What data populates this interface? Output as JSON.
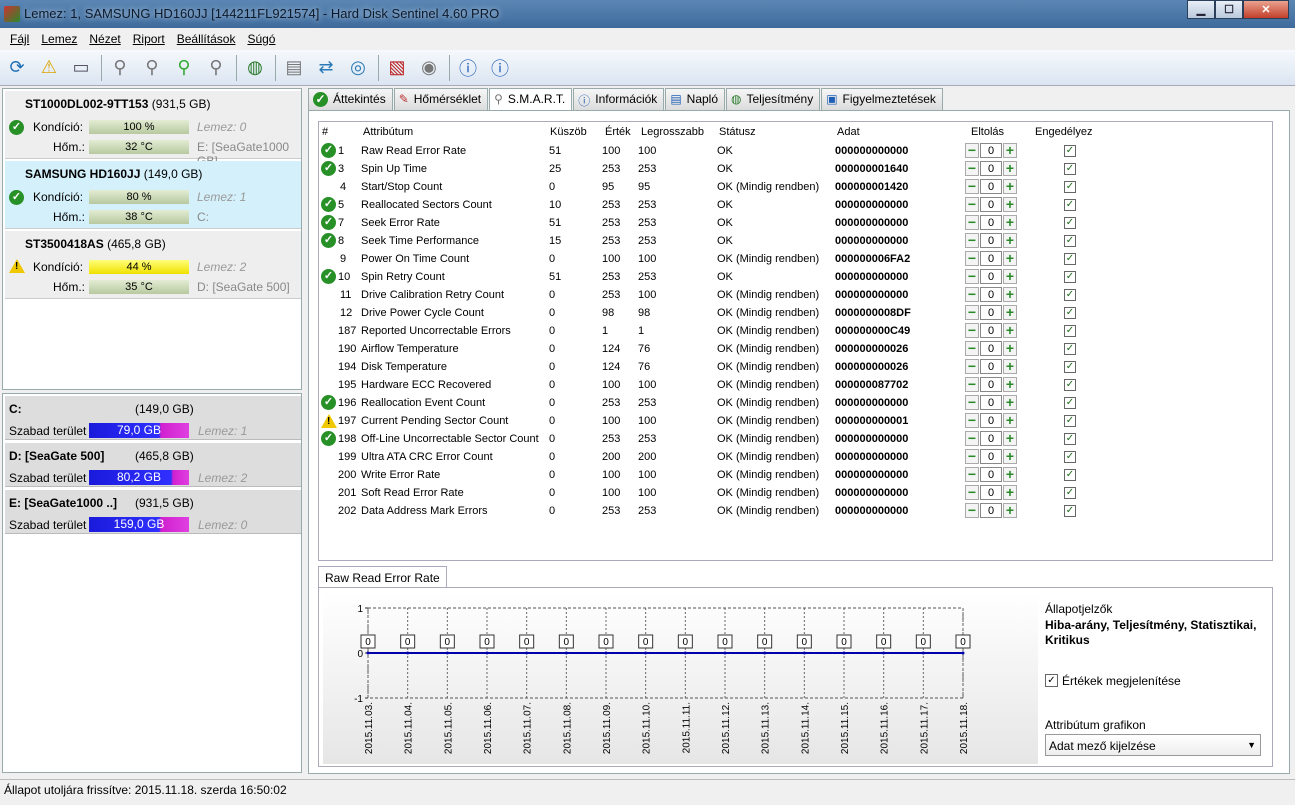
{
  "window": {
    "title": "Lemez: 1, SAMSUNG HD160JJ [144211FL921574]  -  Hard Disk Sentinel 4.60 PRO"
  },
  "menu": [
    "Fájl",
    "Lemez",
    "Nézet",
    "Riport",
    "Beállítások",
    "Súgó"
  ],
  "disks": [
    {
      "name": "ST1000DL002-9TT153",
      "size": "(931,5 GB)",
      "status": "ok",
      "cond_label": "Kondíció:",
      "cond_value": "100 %",
      "cond_side": "Lemez: 0",
      "temp_label": "Hőm.:",
      "temp_value": "32 °C",
      "temp_side": "E: [SeaGate1000 GB]"
    },
    {
      "name": "SAMSUNG HD160JJ",
      "size": "(149,0 GB)",
      "status": "ok",
      "cond_label": "Kondíció:",
      "cond_value": "80 %",
      "cond_side": "Lemez: 1",
      "temp_label": "Hőm.:",
      "temp_value": "38 °C",
      "temp_side": "C:"
    },
    {
      "name": "ST3500418AS",
      "size": "(465,8 GB)",
      "status": "warning",
      "cond_label": "Kondíció:",
      "cond_value": "44 %",
      "cond_side": "Lemez: 2",
      "temp_label": "Hőm.:",
      "temp_value": "35 °C",
      "temp_side": "D: [SeaGate 500]"
    }
  ],
  "volumes": [
    {
      "name": "C:",
      "size": "(149,0 GB)",
      "free_label": "Szabad terület",
      "free": "79,0 GB",
      "side": "Lemez: 1"
    },
    {
      "name": "D: [SeaGate 500]",
      "size": "(465,8 GB)",
      "free_label": "Szabad terület",
      "free": "80,2 GB",
      "side": "Lemez: 2"
    },
    {
      "name": "E: [SeaGate1000 ..]",
      "size": "(931,5 GB)",
      "free_label": "Szabad terület",
      "free": "159,0 GB",
      "side": "Lemez: 0"
    }
  ],
  "tabs": [
    "Áttekintés",
    "Hőmérséklet",
    "S.M.A.R.T.",
    "Információk",
    "Napló",
    "Teljesítmény",
    "Figyelmeztetések"
  ],
  "smart": {
    "headers": [
      "#",
      "Attribútum",
      "Küszöb",
      "Érték",
      "Legrosszabb",
      "Státusz",
      "Adat",
      "Eltolás",
      "Engedélyez"
    ],
    "rows": [
      {
        "icon": "ok",
        "id": "1",
        "name": "Raw Read Error Rate",
        "thr": "51",
        "val": "100",
        "worst": "100",
        "status": "OK",
        "data": "000000000000",
        "offset": "0"
      },
      {
        "icon": "ok",
        "id": "3",
        "name": "Spin Up Time",
        "thr": "25",
        "val": "253",
        "worst": "253",
        "status": "OK",
        "data": "000000001640",
        "offset": "0"
      },
      {
        "icon": "",
        "id": "4",
        "name": "Start/Stop Count",
        "thr": "0",
        "val": "95",
        "worst": "95",
        "status": "OK (Mindig rendben)",
        "data": "000000001420",
        "offset": "0"
      },
      {
        "icon": "ok",
        "id": "5",
        "name": "Reallocated Sectors Count",
        "thr": "10",
        "val": "253",
        "worst": "253",
        "status": "OK",
        "data": "000000000000",
        "offset": "0"
      },
      {
        "icon": "ok",
        "id": "7",
        "name": "Seek Error Rate",
        "thr": "51",
        "val": "253",
        "worst": "253",
        "status": "OK",
        "data": "000000000000",
        "offset": "0"
      },
      {
        "icon": "ok",
        "id": "8",
        "name": "Seek Time Performance",
        "thr": "15",
        "val": "253",
        "worst": "253",
        "status": "OK",
        "data": "000000000000",
        "offset": "0"
      },
      {
        "icon": "",
        "id": "9",
        "name": "Power On Time Count",
        "thr": "0",
        "val": "100",
        "worst": "100",
        "status": "OK (Mindig rendben)",
        "data": "000000006FA2",
        "offset": "0"
      },
      {
        "icon": "ok",
        "id": "10",
        "name": "Spin Retry Count",
        "thr": "51",
        "val": "253",
        "worst": "253",
        "status": "OK",
        "data": "000000000000",
        "offset": "0"
      },
      {
        "icon": "",
        "id": "11",
        "name": "Drive Calibration Retry Count",
        "thr": "0",
        "val": "253",
        "worst": "100",
        "status": "OK (Mindig rendben)",
        "data": "000000000000",
        "offset": "0"
      },
      {
        "icon": "",
        "id": "12",
        "name": "Drive Power Cycle Count",
        "thr": "0",
        "val": "98",
        "worst": "98",
        "status": "OK (Mindig rendben)",
        "data": "0000000008DF",
        "offset": "0"
      },
      {
        "icon": "",
        "id": "187",
        "name": "Reported Uncorrectable Errors",
        "thr": "0",
        "val": "1",
        "worst": "1",
        "status": "OK (Mindig rendben)",
        "data": "000000000C49",
        "offset": "0"
      },
      {
        "icon": "",
        "id": "190",
        "name": "Airflow Temperature",
        "thr": "0",
        "val": "124",
        "worst": "76",
        "status": "OK (Mindig rendben)",
        "data": "000000000026",
        "offset": "0"
      },
      {
        "icon": "",
        "id": "194",
        "name": "Disk Temperature",
        "thr": "0",
        "val": "124",
        "worst": "76",
        "status": "OK (Mindig rendben)",
        "data": "000000000026",
        "offset": "0"
      },
      {
        "icon": "",
        "id": "195",
        "name": "Hardware ECC Recovered",
        "thr": "0",
        "val": "100",
        "worst": "100",
        "status": "OK (Mindig rendben)",
        "data": "000000087702",
        "offset": "0"
      },
      {
        "icon": "ok",
        "id": "196",
        "name": "Reallocation Event Count",
        "thr": "0",
        "val": "253",
        "worst": "253",
        "status": "OK (Mindig rendben)",
        "data": "000000000000",
        "offset": "0"
      },
      {
        "icon": "warning",
        "id": "197",
        "name": "Current Pending Sector Count",
        "thr": "0",
        "val": "100",
        "worst": "100",
        "status": "OK (Mindig rendben)",
        "data": "000000000001",
        "offset": "0"
      },
      {
        "icon": "ok",
        "id": "198",
        "name": "Off-Line Uncorrectable Sector Count",
        "thr": "0",
        "val": "253",
        "worst": "253",
        "status": "OK (Mindig rendben)",
        "data": "000000000000",
        "offset": "0"
      },
      {
        "icon": "",
        "id": "199",
        "name": "Ultra ATA CRC Error Count",
        "thr": "0",
        "val": "200",
        "worst": "200",
        "status": "OK (Mindig rendben)",
        "data": "000000000000",
        "offset": "0"
      },
      {
        "icon": "",
        "id": "200",
        "name": "Write Error Rate",
        "thr": "0",
        "val": "100",
        "worst": "100",
        "status": "OK (Mindig rendben)",
        "data": "000000000000",
        "offset": "0"
      },
      {
        "icon": "",
        "id": "201",
        "name": "Soft Read Error Rate",
        "thr": "0",
        "val": "100",
        "worst": "100",
        "status": "OK (Mindig rendben)",
        "data": "000000000000",
        "offset": "0"
      },
      {
        "icon": "",
        "id": "202",
        "name": "Data Address Mark Errors",
        "thr": "0",
        "val": "253",
        "worst": "253",
        "status": "OK (Mindig rendben)",
        "data": "000000000000",
        "offset": "0"
      }
    ]
  },
  "graph": {
    "tab_label": "Raw Read Error Rate",
    "side_title": "Állapotjelzők",
    "side_text": "Hiba-arány, Teljesítmény, Statisztikai, Kritikus",
    "show_values_label": "Értékek megjelenítése",
    "show_values": true,
    "attr_label": "Attribútum grafikon",
    "attr_select": "Adat mező kijelzése"
  },
  "chart_data": {
    "type": "line",
    "x": [
      "2015.11.03.",
      "2015.11.04.",
      "2015.11.05.",
      "2015.11.06.",
      "2015.11.07.",
      "2015.11.08.",
      "2015.11.09.",
      "2015.11.10.",
      "2015.11.11.",
      "2015.11.12.",
      "2015.11.13.",
      "2015.11.14.",
      "2015.11.15.",
      "2015.11.16.",
      "2015.11.17.",
      "2015.11.18."
    ],
    "values": [
      0,
      0,
      0,
      0,
      0,
      0,
      0,
      0,
      0,
      0,
      0,
      0,
      0,
      0,
      0,
      0
    ],
    "ylim": [
      -1,
      1
    ],
    "yticks": [
      "1",
      "0",
      "-1"
    ],
    "line_color": "#0000aa",
    "grid": true
  },
  "status": {
    "text": "Állapot utoljára frissítve: 2015.11.18. szerda 16:50:02"
  }
}
